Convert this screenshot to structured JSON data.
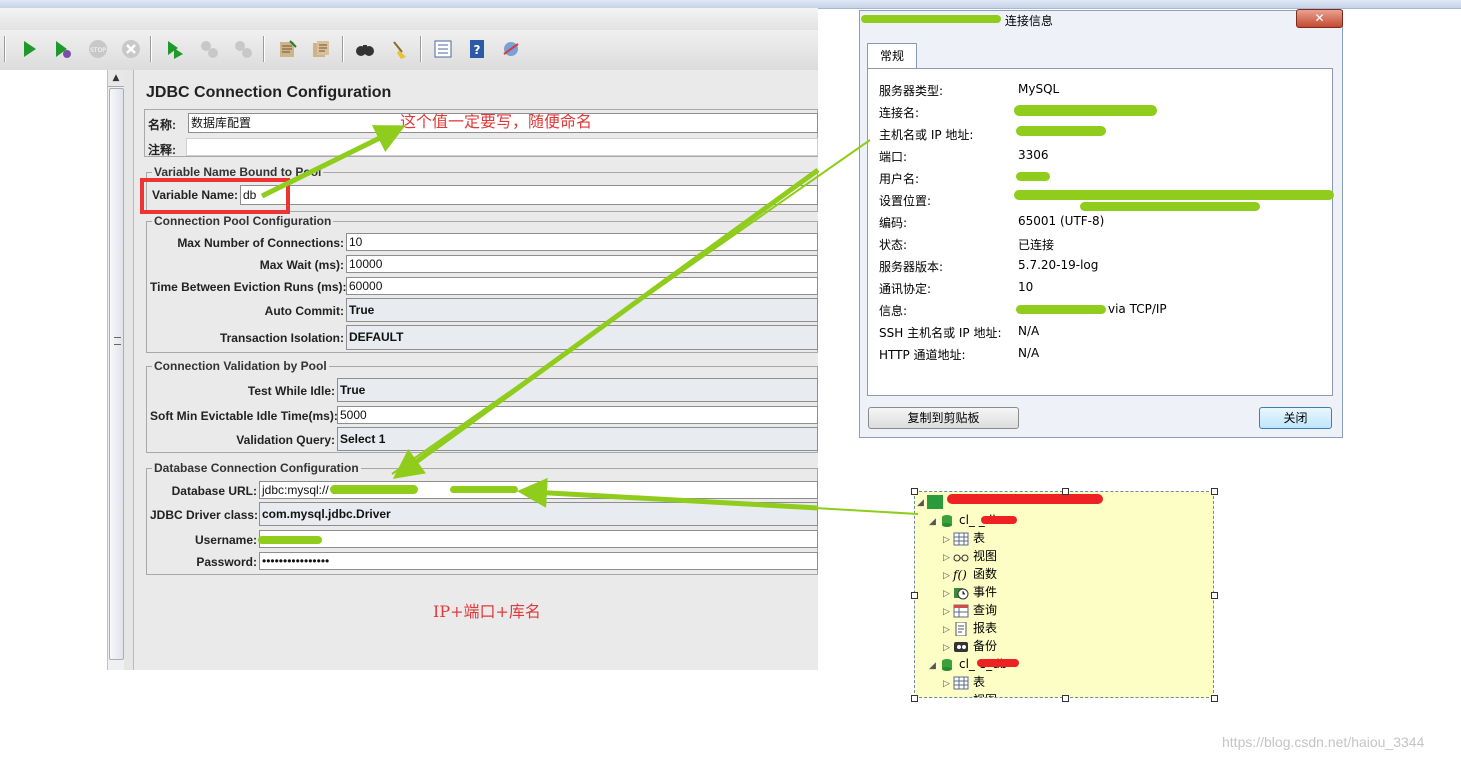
{
  "colors": {
    "annotation_red": "#e03a3a",
    "arrow_green": "#8fcc1b",
    "highlight_red": "#ee3333",
    "panel_bg": "#eaeaea",
    "nav_bg": "#fdfdc6"
  },
  "toolbar": {
    "icons": [
      "start-icon",
      "start-no-timers-icon",
      "stop-icon",
      "shutdown-icon",
      "remote-start-icon",
      "remote-stop-icon",
      "remote-shutdown-icon",
      "clear-icon",
      "clear-all-icon",
      "search-icon",
      "reset-search-icon",
      "function-helper-icon",
      "help-icon",
      "log-viewer-icon"
    ]
  },
  "jdbc": {
    "title": "JDBC Connection Configuration",
    "name_label": "名称:",
    "name_value": "数据库配置",
    "comment_label": "注释:",
    "var_group": "Variable Name Bound to Pool",
    "variable_name_label": "Variable Name:",
    "variable_name_value": "db",
    "pool_group": "Connection Pool Configuration",
    "pool": [
      {
        "label": "Max Number of Connections:",
        "value": "10"
      },
      {
        "label": "Max Wait (ms):",
        "value": "10000"
      },
      {
        "label": "Time Between Eviction Runs (ms):",
        "value": "60000"
      },
      {
        "label": "Auto Commit:",
        "value": "True"
      },
      {
        "label": "Transaction Isolation:",
        "value": "DEFAULT"
      }
    ],
    "validation_group": "Connection Validation by Pool",
    "validation": [
      {
        "label": "Test While Idle:",
        "value": "True"
      },
      {
        "label": "Soft Min Evictable Idle Time(ms):",
        "value": "5000"
      },
      {
        "label": "Validation Query:",
        "value": "Select 1"
      }
    ],
    "db_group": "Database Connection Configuration",
    "db": [
      {
        "label": "Database URL:",
        "value": "jdbc:mysql://                    .3306/                   db"
      },
      {
        "label": "JDBC Driver class:",
        "value": "com.mysql.jdbc.Driver"
      },
      {
        "label": "Username:",
        "value": ""
      },
      {
        "label": "Password:",
        "value": "••••••••••••••••"
      }
    ]
  },
  "annotations": {
    "name_note": "这个值一定要写，随便命名",
    "url_note": "IP+端口+库名"
  },
  "dialog": {
    "title_suffix": "连接信息",
    "close_x": "✕",
    "tab": "常规",
    "rows": [
      {
        "key": "服务器类型:",
        "value": "MySQL"
      },
      {
        "key": "连接名:",
        "value": ""
      },
      {
        "key": "主机名或 IP 地址:",
        "value": ""
      },
      {
        "key": "端口:",
        "value": "3306"
      },
      {
        "key": "用户名:",
        "value": ""
      },
      {
        "key": "设置位置:",
        "value": ""
      },
      {
        "key": "编码:",
        "value": "65001 (UTF-8)"
      },
      {
        "key": "状态:",
        "value": "已连接"
      },
      {
        "key": "服务器版本:",
        "value": "5.7.20-19-log"
      },
      {
        "key": "通讯协定:",
        "value": "10"
      },
      {
        "key": "信息:",
        "value": "via TCP/IP"
      },
      {
        "key": "SSH 主机名或 IP 地址:",
        "value": "N/A"
      },
      {
        "key": "HTTP 通道地址:",
        "value": "N/A"
      }
    ],
    "copy_button": "复制到剪贴板",
    "close_button": "关闭"
  },
  "navicat": {
    "db1": "cl_          _db",
    "db1_items": [
      "表",
      "视图",
      "函数",
      "事件",
      "查询",
      "报表",
      "备份"
    ],
    "db2": "cl_          e_db",
    "db2_items": [
      "表",
      "视图"
    ]
  },
  "watermark": "https://blog.csdn.net/haiou_3344"
}
